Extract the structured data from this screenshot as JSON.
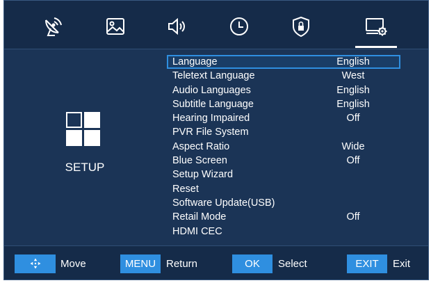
{
  "tabs": [
    {
      "name": "satellite-dish-icon",
      "active": false
    },
    {
      "name": "picture-icon",
      "active": false
    },
    {
      "name": "sound-icon",
      "active": false
    },
    {
      "name": "clock-icon",
      "active": false
    },
    {
      "name": "lock-shield-icon",
      "active": false
    },
    {
      "name": "setup-monitor-gear-icon",
      "active": true
    }
  ],
  "section": {
    "title": "SETUP",
    "icon": "grid-windows-icon"
  },
  "menu": {
    "items": [
      {
        "label": "Language",
        "value": "English",
        "selected": true
      },
      {
        "label": "Teletext Language",
        "value": "West"
      },
      {
        "label": "Audio Languages",
        "value": "English"
      },
      {
        "label": "Subtitle Language",
        "value": "English"
      },
      {
        "label": "Hearing Impaired",
        "value": "Off"
      },
      {
        "label": "PVR File System",
        "value": ""
      },
      {
        "label": "Aspect Ratio",
        "value": "Wide"
      },
      {
        "label": "Blue Screen",
        "value": "Off"
      },
      {
        "label": "Setup Wizard",
        "value": ""
      },
      {
        "label": "Reset",
        "value": ""
      },
      {
        "label": "Software Update(USB)",
        "value": ""
      },
      {
        "label": "Retail Mode",
        "value": "Off"
      },
      {
        "label": "HDMI CEC",
        "value": ""
      }
    ]
  },
  "footer": {
    "move_key_icon": "four-way-arrows-icon",
    "move_label": "Move",
    "menu_key": "MENU",
    "menu_label": "Return",
    "ok_key": "OK",
    "ok_label": "Select",
    "exit_key": "EXIT",
    "exit_label": "Exit"
  },
  "colors": {
    "background": "#1b3456",
    "bar": "#152b49",
    "accent": "#2f8fe0",
    "text": "#ffffff"
  }
}
